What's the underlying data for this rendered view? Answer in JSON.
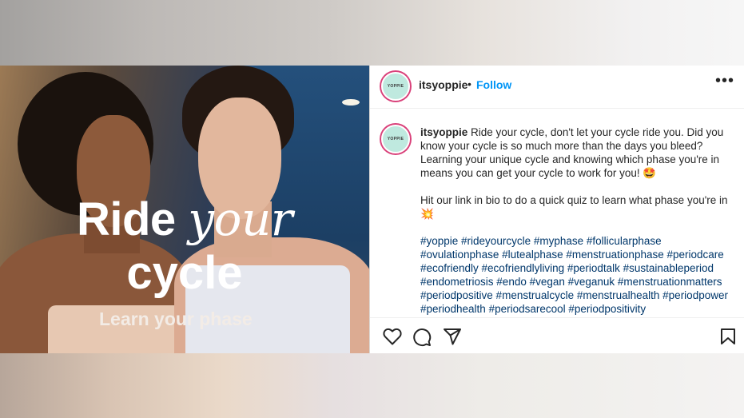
{
  "post": {
    "image_text": {
      "line1_word1": "Ride",
      "line1_word2": "your",
      "line2": "cycle",
      "subtitle": "Learn your phase"
    }
  },
  "header": {
    "avatar_text": "YOPPIE",
    "username": "itsyoppie",
    "separator": "•",
    "follow_label": "Follow",
    "more_label": "•••"
  },
  "caption": {
    "username": "itsyoppie",
    "text1": "Ride your cycle, don't let your cycle ride you. Did you know your cycle is so much more than the days you bleed? Learning your unique cycle and knowing which phase you're in means you can get your cycle to work for you! 🤩",
    "text2": "Hit our link in bio to do a quick quiz to learn what phase you're in 💥",
    "hashtags": "#yoppie #rideyourcycle #myphase #follicularphase #ovulationphase #lutealphase #menstruationphase #periodcare #ecofriendly #ecofriendlyliving #periodtalk #sustainableperiod #endometriosis #endo #vegan #veganuk #menstruationmatters #periodpositive #menstrualcycle #menstrualhealth #periodpower #periodhealth #periodsarecool #periodpositivity"
  },
  "actions": {
    "like_icon": "heart-icon",
    "comment_icon": "comment-icon",
    "share_icon": "paper-plane-icon",
    "save_icon": "bookmark-icon"
  },
  "colors": {
    "link": "#0095f6",
    "hashtag": "#00376b",
    "avatar_bg": "#bfe9df",
    "ring": "#d9417a"
  }
}
